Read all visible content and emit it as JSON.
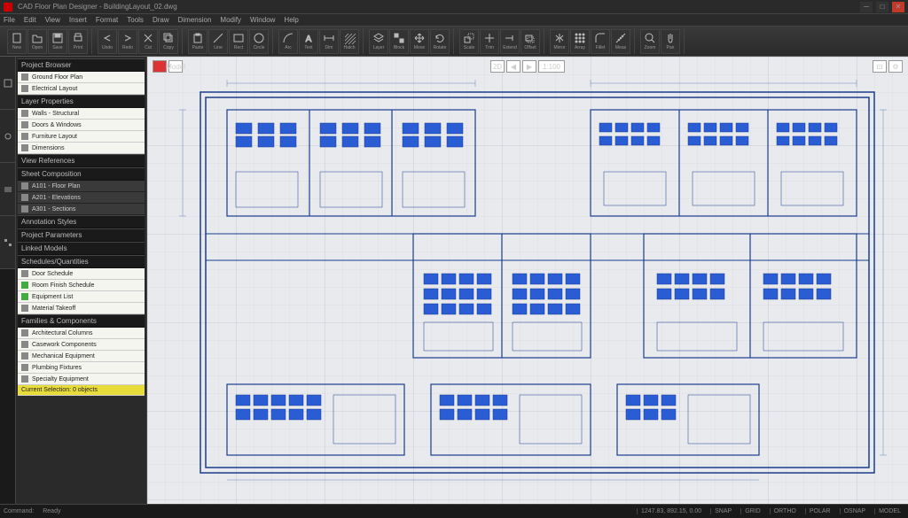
{
  "title": "CAD Floor Plan Designer - BuildingLayout_02.dwg",
  "menu": [
    "File",
    "Edit",
    "View",
    "Insert",
    "Format",
    "Tools",
    "Draw",
    "Dimension",
    "Modify",
    "Window",
    "Help"
  ],
  "ribbon": [
    {
      "name": "new",
      "label": "New"
    },
    {
      "name": "open",
      "label": "Open"
    },
    {
      "name": "save",
      "label": "Save"
    },
    {
      "name": "print",
      "label": "Print"
    },
    {
      "name": "undo",
      "label": "Undo"
    },
    {
      "name": "redo",
      "label": "Redo"
    },
    {
      "name": "cut",
      "label": "Cut"
    },
    {
      "name": "copy",
      "label": "Copy"
    },
    {
      "name": "paste",
      "label": "Paste"
    },
    {
      "name": "line",
      "label": "Line"
    },
    {
      "name": "rect",
      "label": "Rect"
    },
    {
      "name": "circle",
      "label": "Circle"
    },
    {
      "name": "arc",
      "label": "Arc"
    },
    {
      "name": "text",
      "label": "Text"
    },
    {
      "name": "dim",
      "label": "Dim"
    },
    {
      "name": "hatch",
      "label": "Hatch"
    },
    {
      "name": "layer",
      "label": "Layer"
    },
    {
      "name": "block",
      "label": "Block"
    },
    {
      "name": "move",
      "label": "Move"
    },
    {
      "name": "rotate",
      "label": "Rotate"
    },
    {
      "name": "scale",
      "label": "Scale"
    },
    {
      "name": "trim",
      "label": "Trim"
    },
    {
      "name": "extend",
      "label": "Extend"
    },
    {
      "name": "offset",
      "label": "Offset"
    },
    {
      "name": "mirror",
      "label": "Mirror"
    },
    {
      "name": "array",
      "label": "Array"
    },
    {
      "name": "fillet",
      "label": "Fillet"
    },
    {
      "name": "measure",
      "label": "Meas"
    },
    {
      "name": "zoom",
      "label": "Zoom"
    },
    {
      "name": "pan",
      "label": "Pan"
    }
  ],
  "sidebar": {
    "header1": "Project Browser",
    "items1": [
      {
        "label": "Ground Floor Plan"
      },
      {
        "label": "Electrical Layout"
      }
    ],
    "header2": "Layer Properties",
    "items2": [
      {
        "label": "Walls - Structural"
      },
      {
        "label": "Doors & Windows"
      },
      {
        "label": "Furniture Layout"
      },
      {
        "label": "Dimensions"
      }
    ],
    "header3": "View References",
    "header4": "Sheet Composition",
    "items4": [
      {
        "label": "A101 - Floor Plan"
      },
      {
        "label": "A201 - Elevations"
      },
      {
        "label": "A301 - Sections"
      }
    ],
    "header5": "Annotation Styles",
    "header6": "Project Parameters",
    "header7": "Linked Models",
    "header8": "Schedules/Quantities",
    "items8": [
      {
        "label": "Door Schedule"
      },
      {
        "label": "Room Finish Schedule",
        "green": true
      },
      {
        "label": "Equipment List",
        "green": true
      },
      {
        "label": "Material Takeoff"
      }
    ],
    "header9": "Families & Components",
    "items9": [
      {
        "label": "Architectural Columns"
      },
      {
        "label": "Casework Components"
      },
      {
        "label": "Mechanical Equipment"
      },
      {
        "label": "Plumbing Fixtures"
      },
      {
        "label": "Specialty Equipment"
      }
    ],
    "highlight": "Current Selection: 0 objects"
  },
  "canvas": {
    "tab_label": "Model",
    "scale_label": "1:100",
    "view_label": "2D"
  },
  "status": {
    "left1": "Command:",
    "left2": "Ready",
    "coords": "1247.83, 892.15, 0.00",
    "snap": "SNAP",
    "grid": "GRID",
    "ortho": "ORTHO",
    "polar": "POLAR",
    "osnap": "OSNAP",
    "model": "MODEL"
  }
}
